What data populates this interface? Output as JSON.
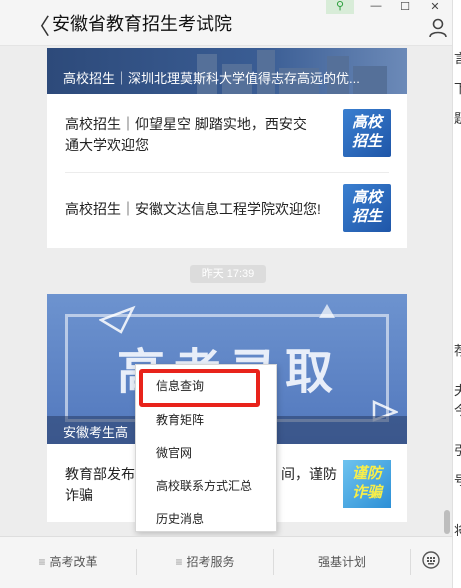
{
  "header": {
    "back_glyph": "〈",
    "title": "安徽省教育招生考试院",
    "window_controls": {
      "pin": "⚲",
      "minimize": "—",
      "maximize": "☐",
      "close": "✕"
    }
  },
  "right_panel": {
    "chars": [
      "言",
      "下",
      "题",
      "荐",
      "夫",
      "今",
      "引",
      "号",
      "将"
    ]
  },
  "card1": {
    "banner_text": "高校招生｜深圳北理莫斯科大学值得志存高远的优...",
    "items": [
      {
        "text": "高校招生｜仰望星空 脚踏实地，西安交通大学欢迎您",
        "thumb": [
          "高校",
          "招生"
        ]
      },
      {
        "text": "高校招生｜安徽文达信息工程学院欢迎您!",
        "thumb": [
          "高校",
          "招生"
        ]
      }
    ]
  },
  "timestamp": "昨天 17:39",
  "card2": {
    "banner_big_title": "高考录取",
    "banner_caption": "安徽考生高",
    "item_text_line1": "教育部发布",
    "item_text_line1_right": "间，谨防",
    "item_text_line2": "诈骗",
    "thumb": [
      "谨防",
      "诈骗"
    ]
  },
  "context_menu": {
    "items": [
      "信息查询",
      "教育矩阵",
      "微官网",
      "高校联系方式汇总",
      "历史消息"
    ],
    "highlighted_index": 0,
    "highlight_color": "#e8231b"
  },
  "bottom_tabs": {
    "tabs": [
      "高考改革",
      "招考服务",
      "强基计划"
    ],
    "keyboard_icon": "keyboard-icon"
  }
}
